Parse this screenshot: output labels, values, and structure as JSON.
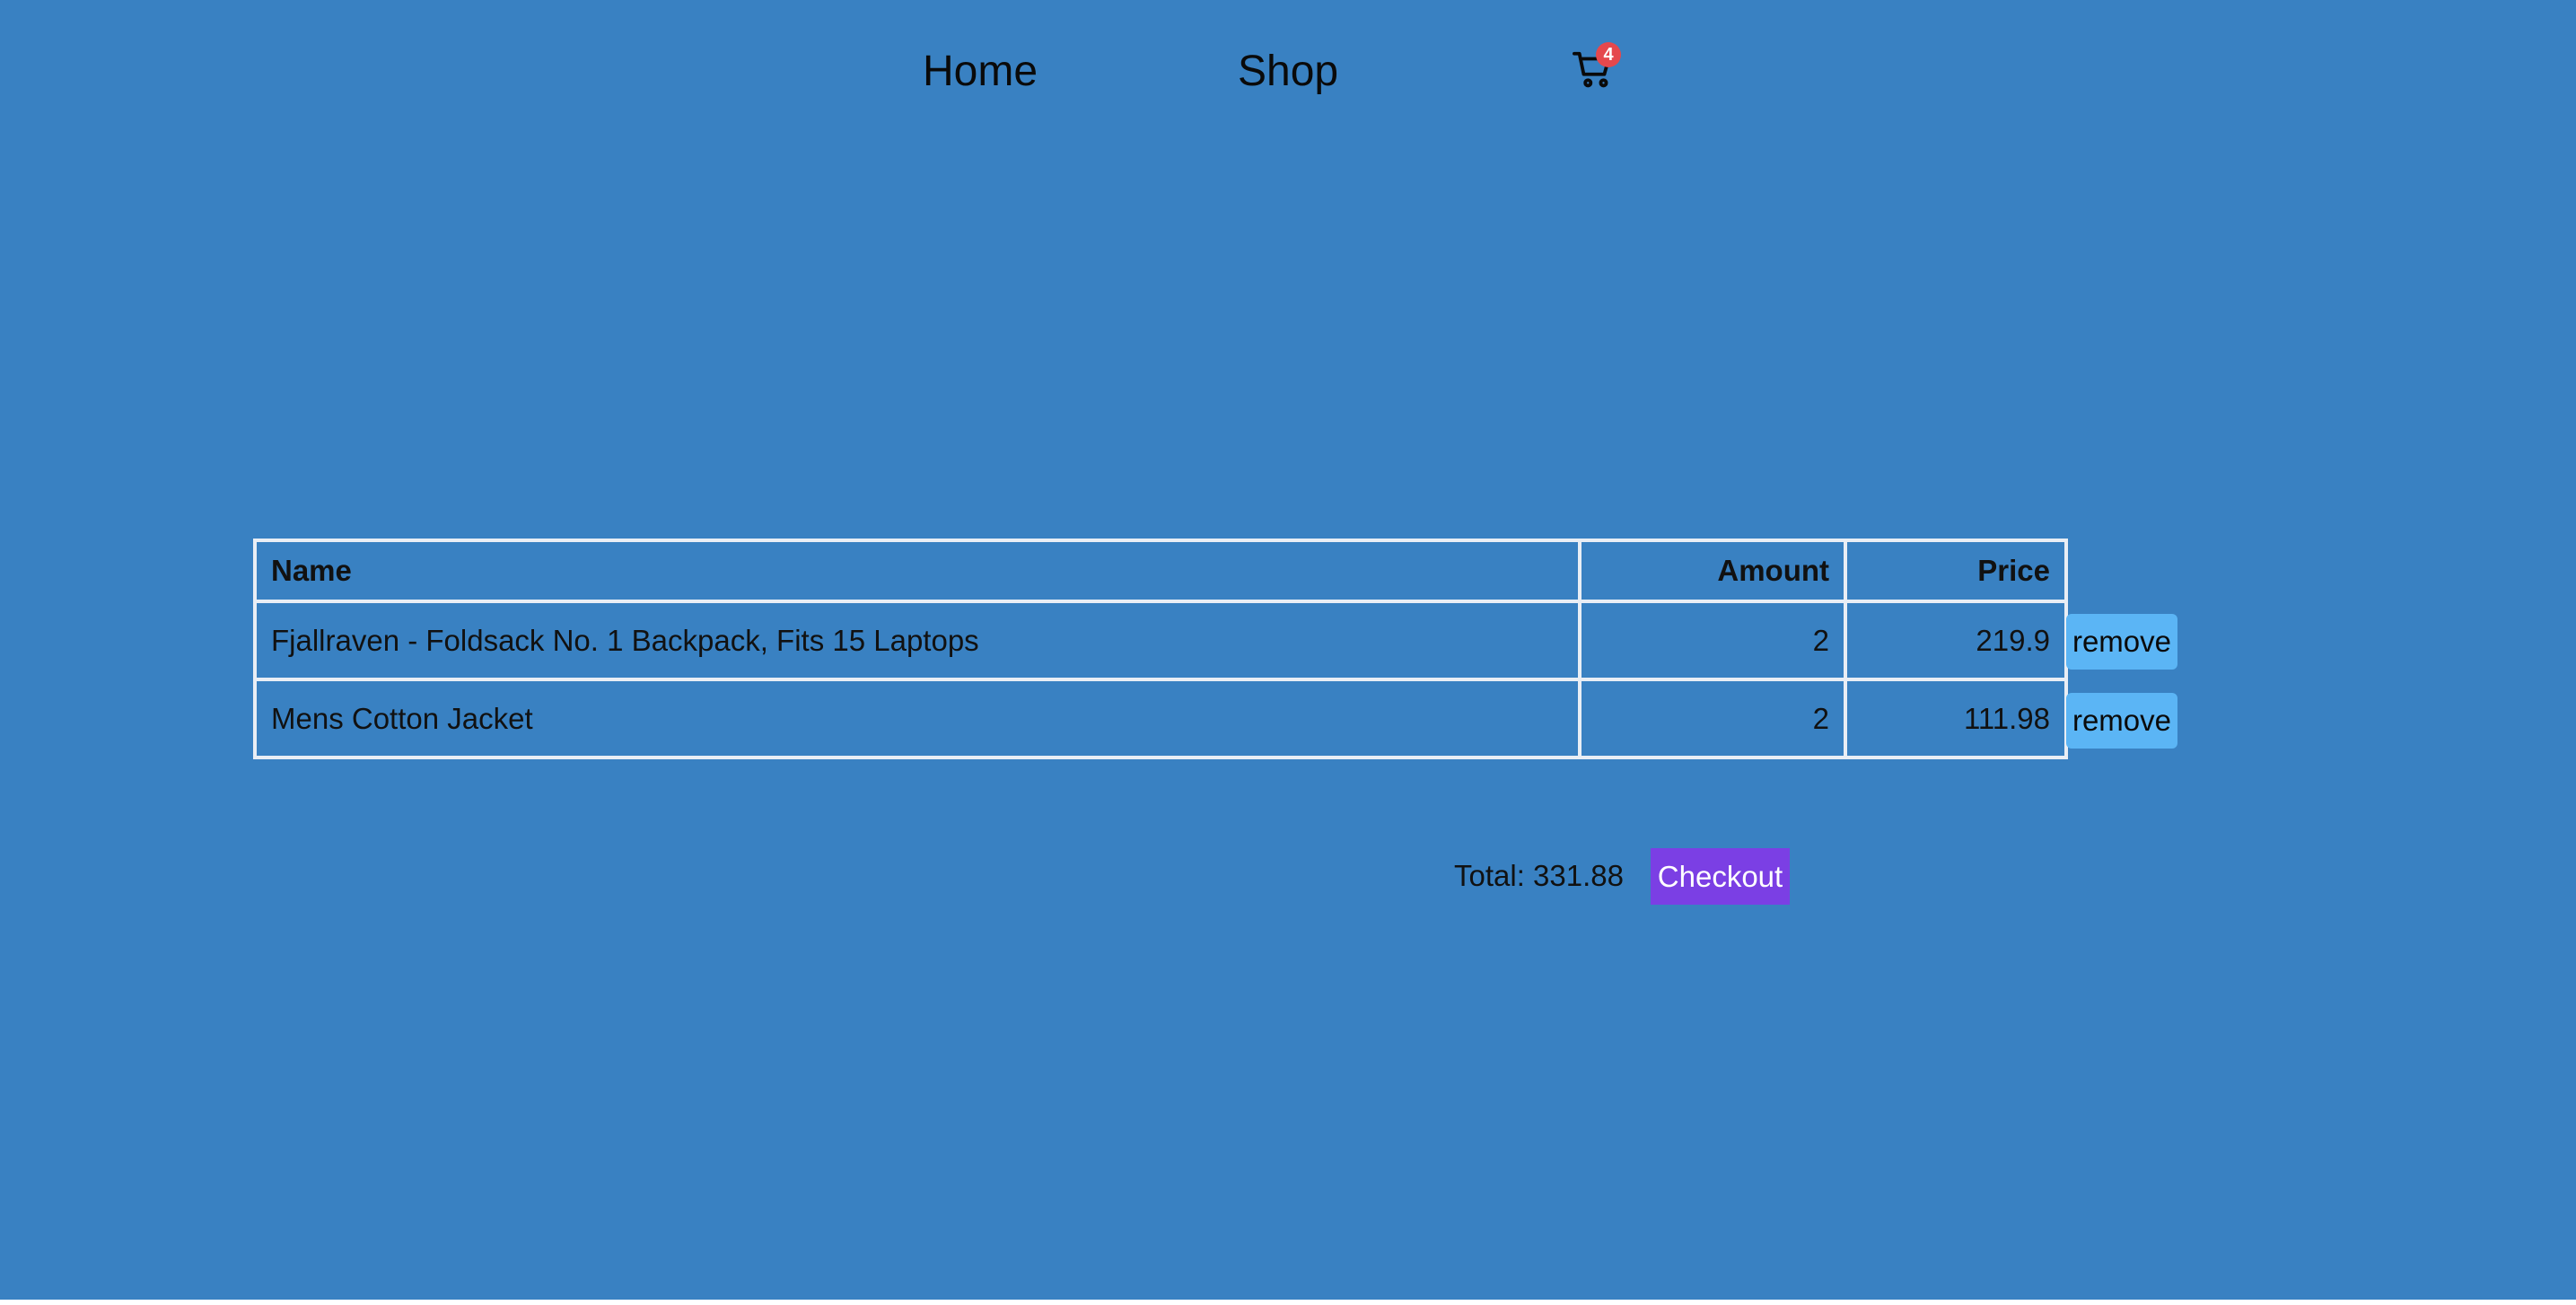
{
  "nav": {
    "home_label": "Home",
    "shop_label": "Shop",
    "cart_icon": "shopping-cart-icon",
    "cart_count": "4"
  },
  "cart_table": {
    "headers": [
      "Name",
      "Amount",
      "Price"
    ],
    "rows": [
      {
        "name": "Fjallraven - Foldsack No. 1 Backpack, Fits 15 Laptops",
        "amount": "2",
        "price": "219.9",
        "remove_label": "remove"
      },
      {
        "name": "Mens Cotton Jacket",
        "amount": "2",
        "price": "111.98",
        "remove_label": "remove"
      }
    ]
  },
  "summary": {
    "total_text": "Total: 331.88",
    "checkout_label": "Checkout"
  },
  "colors": {
    "background": "#3981c2",
    "badge": "#e5484d",
    "remove_button": "#5bb5f5",
    "checkout_button": "#7b3fe4",
    "table_border": "#e9eef5"
  }
}
